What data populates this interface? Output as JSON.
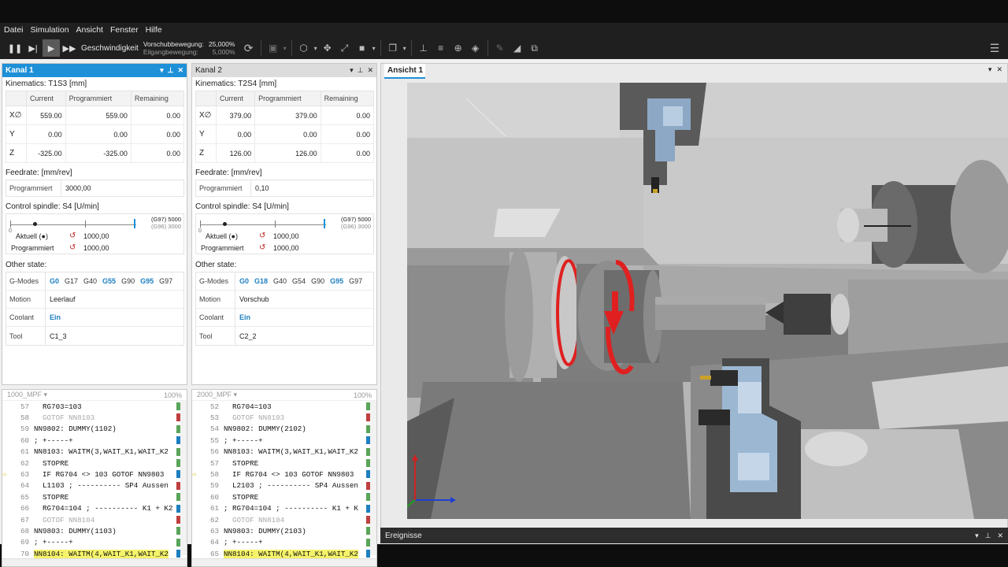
{
  "menu": [
    "Datei",
    "Simulation",
    "Ansicht",
    "Fenster",
    "Hilfe"
  ],
  "toolbar": {
    "speed_label": "Geschwindigkeit",
    "feed_label": "Vorschubbewegung:",
    "feed_value": "25,000%",
    "rapid_label": "Eilgangbewegung:",
    "rapid_value": "5,000%"
  },
  "channels": [
    {
      "title": "Kanal 1",
      "kinematics_label": "Kinematics:",
      "kinematics": "T1S3",
      "unit": "[mm]",
      "headers": [
        "Current",
        "Programmiert",
        "Remaining"
      ],
      "axes": [
        {
          "name": "X∅",
          "current": "559.00",
          "prog": "559.00",
          "rem": "0.00"
        },
        {
          "name": "Y",
          "current": "0.00",
          "prog": "0.00",
          "rem": "0.00"
        },
        {
          "name": "Z",
          "current": "-325.00",
          "prog": "-325.00",
          "rem": "0.00"
        }
      ],
      "feedrate_label": "Feedrate:",
      "feedrate_unit": "[mm/rev]",
      "feed_prog_label": "Programmiert",
      "feed_prog": "3000,00",
      "spindle_label": "Control spindle:",
      "spindle": "S4",
      "spindle_unit": "[U/min]",
      "g97": "(G97) 5000",
      "g96": "(G96) 3000",
      "zero": "0",
      "actual_label": "Aktuell (●)",
      "actual": "1000,00",
      "prog_label": "Programmiert",
      "prog": "1000,00",
      "other_label": "Other state:",
      "gmodes_label": "G-Modes",
      "gmodes": [
        {
          "t": "G0",
          "b": true
        },
        {
          "t": "G17",
          "b": false
        },
        {
          "t": "G40",
          "b": false
        },
        {
          "t": "G55",
          "b": true
        },
        {
          "t": "G90",
          "b": false
        },
        {
          "t": "G95",
          "b": true
        },
        {
          "t": "G97",
          "b": false
        }
      ],
      "motion_label": "Motion",
      "motion": "Leerlauf",
      "coolant_label": "Coolant",
      "coolant": "Ein",
      "tool_label": "Tool",
      "tool": "C1_3"
    },
    {
      "title": "Kanal 2",
      "kinematics_label": "Kinematics:",
      "kinematics": "T2S4",
      "unit": "[mm]",
      "headers": [
        "Current",
        "Programmiert",
        "Remaining"
      ],
      "axes": [
        {
          "name": "X∅",
          "current": "379.00",
          "prog": "379.00",
          "rem": "0.00"
        },
        {
          "name": "Y",
          "current": "0.00",
          "prog": "0.00",
          "rem": "0.00"
        },
        {
          "name": "Z",
          "current": "126.00",
          "prog": "126.00",
          "rem": "0.00"
        }
      ],
      "feedrate_label": "Feedrate:",
      "feedrate_unit": "[mm/rev]",
      "feed_prog_label": "Programmiert",
      "feed_prog": "0,10",
      "spindle_label": "Control spindle:",
      "spindle": "S4",
      "spindle_unit": "[U/min]",
      "g97": "(G97) 5000",
      "g96": "(G96) 3000",
      "zero": "0",
      "actual_label": "Aktuell (●)",
      "actual": "1000,00",
      "prog_label": "Programmiert",
      "prog": "1000,00",
      "other_label": "Other state:",
      "gmodes_label": "G-Modes",
      "gmodes": [
        {
          "t": "G0",
          "b": true
        },
        {
          "t": "G18",
          "b": true
        },
        {
          "t": "G40",
          "b": false
        },
        {
          "t": "G54",
          "b": false
        },
        {
          "t": "G90",
          "b": false
        },
        {
          "t": "G95",
          "b": true
        },
        {
          "t": "G97",
          "b": false
        }
      ],
      "motion_label": "Motion",
      "motion": "Vorschub",
      "coolant_label": "Coolant",
      "coolant": "Ein",
      "tool_label": "Tool",
      "tool": "C2_2"
    }
  ],
  "programs": [
    {
      "name": "1000_MPF",
      "zoom": "100%",
      "lines": [
        {
          "n": "57",
          "t": "  RG703=103",
          "g": false
        },
        {
          "n": "58",
          "t": "  GOTOF NN8103",
          "g": true
        },
        {
          "n": "59",
          "t": "NN9802: DUMMY(1102)",
          "g": false
        },
        {
          "n": "60",
          "t": "; +-----+",
          "g": false
        },
        {
          "n": "61",
          "t": "NN8103: WAITM(3,WAIT_K1,WAIT_K2",
          "g": false
        },
        {
          "n": "62",
          "t": "  STOPRE",
          "g": false
        },
        {
          "n": "63",
          "t": "  IF RG704 <> 103 GOTOF NN9803",
          "g": false,
          "cur": true
        },
        {
          "n": "64",
          "t": "  L1103 ; ---------- SP4 Aussen",
          "g": false
        },
        {
          "n": "65",
          "t": "  STOPRE",
          "g": false
        },
        {
          "n": "66",
          "t": "  RG704=104 ; ---------- K1 + K2",
          "g": false
        },
        {
          "n": "67",
          "t": "  GOTOF NN8104",
          "g": true
        },
        {
          "n": "68",
          "t": "NN9803: DUMMY(1103)",
          "g": false
        },
        {
          "n": "69",
          "t": "; +-----+",
          "g": false
        },
        {
          "n": "70",
          "t": "NN8104: WAITM(4,WAIT_K1,WAIT_K2",
          "g": false,
          "hl": true
        }
      ]
    },
    {
      "name": "2000_MPF",
      "zoom": "100%",
      "lines": [
        {
          "n": "52",
          "t": "  RG704=103",
          "g": false
        },
        {
          "n": "53",
          "t": "  GOTOF NN8103",
          "g": true
        },
        {
          "n": "54",
          "t": "NN9802: DUMMY(2102)",
          "g": false
        },
        {
          "n": "55",
          "t": "; +-----+",
          "g": false
        },
        {
          "n": "56",
          "t": "NN8103: WAITM(3,WAIT_K1,WAIT_K2",
          "g": false
        },
        {
          "n": "57",
          "t": "  STOPRE",
          "g": false
        },
        {
          "n": "58",
          "t": "  IF RG704 <> 103 GOTOF NN9803",
          "g": false,
          "cur": true
        },
        {
          "n": "59",
          "t": "  L2103 ; ---------- SP4 Aussen",
          "g": false
        },
        {
          "n": "60",
          "t": "  STOPRE",
          "g": false
        },
        {
          "n": "61",
          "t": "; RG704=104 ; ---------- K1 + K",
          "g": false
        },
        {
          "n": "62",
          "t": "  GOTOF NN8104",
          "g": true
        },
        {
          "n": "63",
          "t": "NN9803: DUMMY(2103)",
          "g": false
        },
        {
          "n": "64",
          "t": "; +-----+",
          "g": false
        },
        {
          "n": "65",
          "t": "NN8104: WAITM(4,WAIT_K1,WAIT_K2",
          "g": false,
          "hl": true
        }
      ]
    }
  ],
  "view": {
    "tab": "Ansicht 1"
  },
  "events": {
    "title": "Ereignisse"
  },
  "colors": {
    "accent": "#1e90d8",
    "highlight": "#f5f36a",
    "spindle_arrow": "#e02020"
  }
}
